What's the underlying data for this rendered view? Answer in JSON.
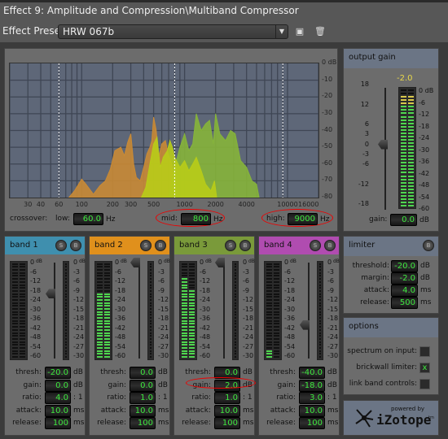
{
  "window": {
    "title": "Effect 9: Amplitude and Compression\\Multiband Compressor"
  },
  "preset": {
    "label": "Effect Preset:",
    "value": "HRW 067b",
    "save_icon": "floppy-disk-icon",
    "delete_icon": "trash-icon"
  },
  "spectrum": {
    "db_ticks": [
      "0 dB",
      "-10",
      "-20",
      "-30",
      "-40",
      "-50",
      "-60",
      "-70",
      "-80"
    ],
    "hz_ticks": [
      {
        "f": 14,
        "t": "Hz"
      },
      {
        "f": 30,
        "t": "30"
      },
      {
        "f": 40,
        "t": "40"
      },
      {
        "f": 60,
        "t": "60"
      },
      {
        "f": 100,
        "t": "100"
      },
      {
        "f": 200,
        "t": "200"
      },
      {
        "f": 300,
        "t": "300"
      },
      {
        "f": 500,
        "t": "500"
      },
      {
        "f": 1000,
        "t": "1000"
      },
      {
        "f": 2000,
        "t": "2000"
      },
      {
        "f": 4000,
        "t": "4000"
      },
      {
        "f": 10000,
        "t": "10000"
      },
      {
        "f": 16000,
        "t": "16000"
      }
    ],
    "freq_range": [
      20,
      20000
    ],
    "db_range": [
      -80,
      0
    ],
    "scale": "log",
    "colors": {
      "band2": "#c48a3a",
      "band3": "#b8cc1c",
      "band4": "#86b03a",
      "crossover_line": "#ffffff",
      "bg": "#5e6778"
    },
    "series": [
      {
        "band": "band2",
        "color": "#c98a35",
        "points": [
          [
            75,
            -80
          ],
          [
            85,
            -76
          ],
          [
            100,
            -69
          ],
          [
            110,
            -72
          ],
          [
            130,
            -78
          ],
          [
            150,
            -73
          ],
          [
            170,
            -70
          ],
          [
            190,
            -63
          ],
          [
            210,
            -52
          ],
          [
            240,
            -50
          ],
          [
            260,
            -55
          ],
          [
            280,
            -47
          ],
          [
            300,
            -42
          ],
          [
            320,
            -60
          ],
          [
            340,
            -68
          ],
          [
            370,
            -70
          ],
          [
            400,
            -62
          ],
          [
            430,
            -54
          ],
          [
            460,
            -50
          ],
          [
            480,
            -46
          ],
          [
            500,
            -32
          ],
          [
            530,
            -40
          ],
          [
            560,
            -56
          ],
          [
            600,
            -48
          ],
          [
            650,
            -46
          ],
          [
            700,
            -55
          ],
          [
            750,
            -60
          ],
          [
            800,
            -80
          ]
        ]
      },
      {
        "band": "band4",
        "color": "#86b43a",
        "points": [
          [
            700,
            -80
          ],
          [
            800,
            -62
          ],
          [
            900,
            -50
          ],
          [
            1000,
            -42
          ],
          [
            1100,
            -52
          ],
          [
            1200,
            -48
          ],
          [
            1300,
            -30
          ],
          [
            1450,
            -40
          ],
          [
            1600,
            -36
          ],
          [
            1750,
            -34
          ],
          [
            1900,
            -48
          ],
          [
            2000,
            -30
          ],
          [
            2200,
            -42
          ],
          [
            2500,
            -46
          ],
          [
            2800,
            -40
          ],
          [
            3100,
            -42
          ],
          [
            3500,
            -58
          ],
          [
            4000,
            -62
          ],
          [
            4500,
            -70
          ],
          [
            5000,
            -72
          ],
          [
            5300,
            -80
          ]
        ]
      },
      {
        "band": "band3",
        "color": "#b8cc18",
        "points": [
          [
            380,
            -80
          ],
          [
            420,
            -74
          ],
          [
            460,
            -60
          ],
          [
            500,
            -48
          ],
          [
            540,
            -44
          ],
          [
            580,
            -62
          ],
          [
            620,
            -56
          ],
          [
            680,
            -52
          ],
          [
            720,
            -46
          ],
          [
            760,
            -50
          ],
          [
            800,
            -56
          ],
          [
            900,
            -62
          ],
          [
            1000,
            -58
          ],
          [
            1100,
            -64
          ],
          [
            1200,
            -60
          ],
          [
            1300,
            -56
          ],
          [
            1450,
            -64
          ],
          [
            1600,
            -72
          ],
          [
            1800,
            -76
          ],
          [
            1950,
            -70
          ],
          [
            2050,
            -80
          ]
        ]
      }
    ],
    "crossover_freqs": [
      60,
      800,
      9000
    ]
  },
  "crossover": {
    "label": "crossover:",
    "low": {
      "label": "low:",
      "value": "60.0",
      "unit": "Hz"
    },
    "mid": {
      "label": "mid:",
      "value": "800",
      "unit": "Hz"
    },
    "high": {
      "label": "high:",
      "value": "9000",
      "unit": "Hz"
    }
  },
  "meter_scale_left": [
    "0",
    "-6",
    "-12",
    "-18",
    "-24",
    "-30",
    "-36",
    "-42",
    "-48",
    "-54",
    "-60"
  ],
  "meter_scale_right": [
    "0",
    "-3",
    "-6",
    "-9",
    "-12",
    "-15",
    "-18",
    "-21",
    "-24",
    "-27",
    "-30"
  ],
  "db_unit": "dB",
  "param_labels": {
    "thresh": "thresh:",
    "gain": "gain:",
    "ratio": "ratio:",
    "attack": "attack:",
    "release": "release:"
  },
  "param_units": {
    "thresh": "dB",
    "gain": "dB",
    "ratio": ": 1",
    "attack": "ms",
    "release": "ms"
  },
  "bands": [
    {
      "name": "band 1",
      "color": "#3f8fae",
      "solo": "S",
      "bypass": "B",
      "thresh": "-20.0",
      "gain": "0.0",
      "ratio": "4.0",
      "attack": "10.0",
      "release": "100",
      "slider_db": -20,
      "level_l": 0,
      "level_r": 0,
      "gr": 0
    },
    {
      "name": "band 2",
      "color": "#e0901c",
      "solo": "S",
      "bypass": "B",
      "thresh": "0.0",
      "gain": "0.0",
      "ratio": "1.0",
      "attack": "10.0",
      "release": "100",
      "slider_db": 0,
      "level_l": 0.7,
      "level_r": 0.7,
      "gr": 0
    },
    {
      "name": "band 3",
      "color": "#7a9a3a",
      "solo": "S",
      "bypass": "B",
      "thresh": "0.0",
      "gain": "2.0",
      "ratio": "1.0",
      "attack": "10.0",
      "release": "100",
      "slider_db": 0,
      "level_l": 0.86,
      "level_r": 0.74,
      "gr": 0
    },
    {
      "name": "band 4",
      "color": "#b04cb0",
      "solo": "S",
      "bypass": "B",
      "thresh": "-40.0",
      "gain": "-18.0",
      "ratio": "3.0",
      "attack": "10.0",
      "release": "100",
      "slider_db": -40,
      "level_l": 0.1,
      "level_r": 0,
      "gr": 0
    }
  ],
  "output_gain": {
    "title": "output gain",
    "peak": "-2.0",
    "scale": [
      "18",
      "12",
      "6",
      "3",
      "0",
      "-3",
      "-6",
      "-12",
      "-18"
    ],
    "meter_scale": [
      "0 dB",
      "-6",
      "-12",
      "-18",
      "-24",
      "-30",
      "-36",
      "-42",
      "-48",
      "-54",
      "-60"
    ],
    "gain_label": "gain:",
    "gain_value": "0.0",
    "unit": "dB",
    "slider_db": 0,
    "level": 0.96
  },
  "limiter": {
    "title": "limiter",
    "bypass": "B",
    "rows": [
      {
        "label": "threshold:",
        "value": "-20.0",
        "unit": "dB"
      },
      {
        "label": "margin:",
        "value": "-2.0",
        "unit": "dB"
      },
      {
        "label": "attack:",
        "value": "4.0",
        "unit": "ms"
      },
      {
        "label": "release:",
        "value": "500",
        "unit": "ms"
      }
    ]
  },
  "options": {
    "title": "options",
    "rows": [
      {
        "label": "spectrum on input:",
        "checked": false
      },
      {
        "label": "brickwall limiter:",
        "checked": true,
        "mark": "x"
      },
      {
        "label": "link band controls:",
        "checked": false
      }
    ]
  },
  "logo": {
    "powered_by": "powered by",
    "brand": "iZotope",
    "tm": "tm"
  }
}
